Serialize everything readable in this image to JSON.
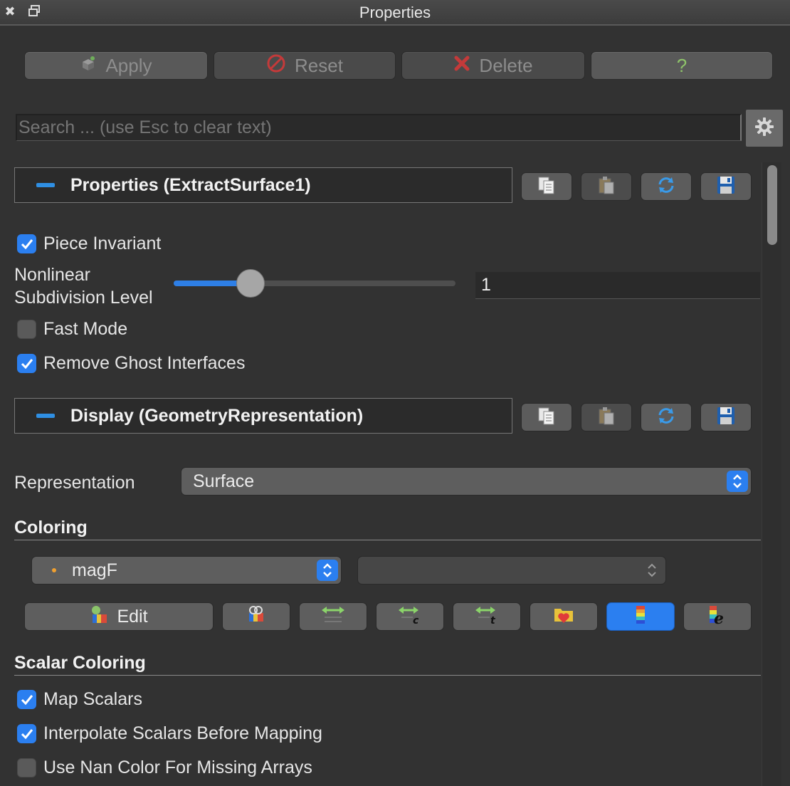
{
  "window": {
    "title": "Properties"
  },
  "toolbar": {
    "apply": "Apply",
    "reset": "Reset",
    "delete": "Delete",
    "help": "?"
  },
  "search": {
    "placeholder": "Search ... (use Esc to clear text)"
  },
  "properties_section": {
    "title": "Properties (ExtractSurface1)",
    "piece_invariant": {
      "label": "Piece Invariant",
      "checked": true
    },
    "nonlinear_line1": "Nonlinear",
    "nonlinear_line2": "Subdivision Level",
    "nonlinear_value": "1",
    "fast_mode": {
      "label": "Fast Mode",
      "checked": false
    },
    "remove_ghost": {
      "label": "Remove Ghost Interfaces",
      "checked": true
    }
  },
  "display_section": {
    "title": "Display (GeometryRepresentation)",
    "representation_label": "Representation",
    "representation_value": "Surface"
  },
  "coloring": {
    "title": "Coloring",
    "array_value": "magF",
    "component_value": "",
    "edit_label": "Edit"
  },
  "scalar_coloring": {
    "title": "Scalar Coloring",
    "map_scalars": {
      "label": "Map Scalars",
      "checked": true
    },
    "interpolate": {
      "label": "Interpolate Scalars Before Mapping",
      "checked": true
    },
    "nan_color": {
      "label": "Use Nan Color For Missing Arrays",
      "checked": false
    }
  },
  "colors": {
    "accent": "#2b7ff0",
    "panel": "#323232",
    "button": "#5e5e5e"
  }
}
